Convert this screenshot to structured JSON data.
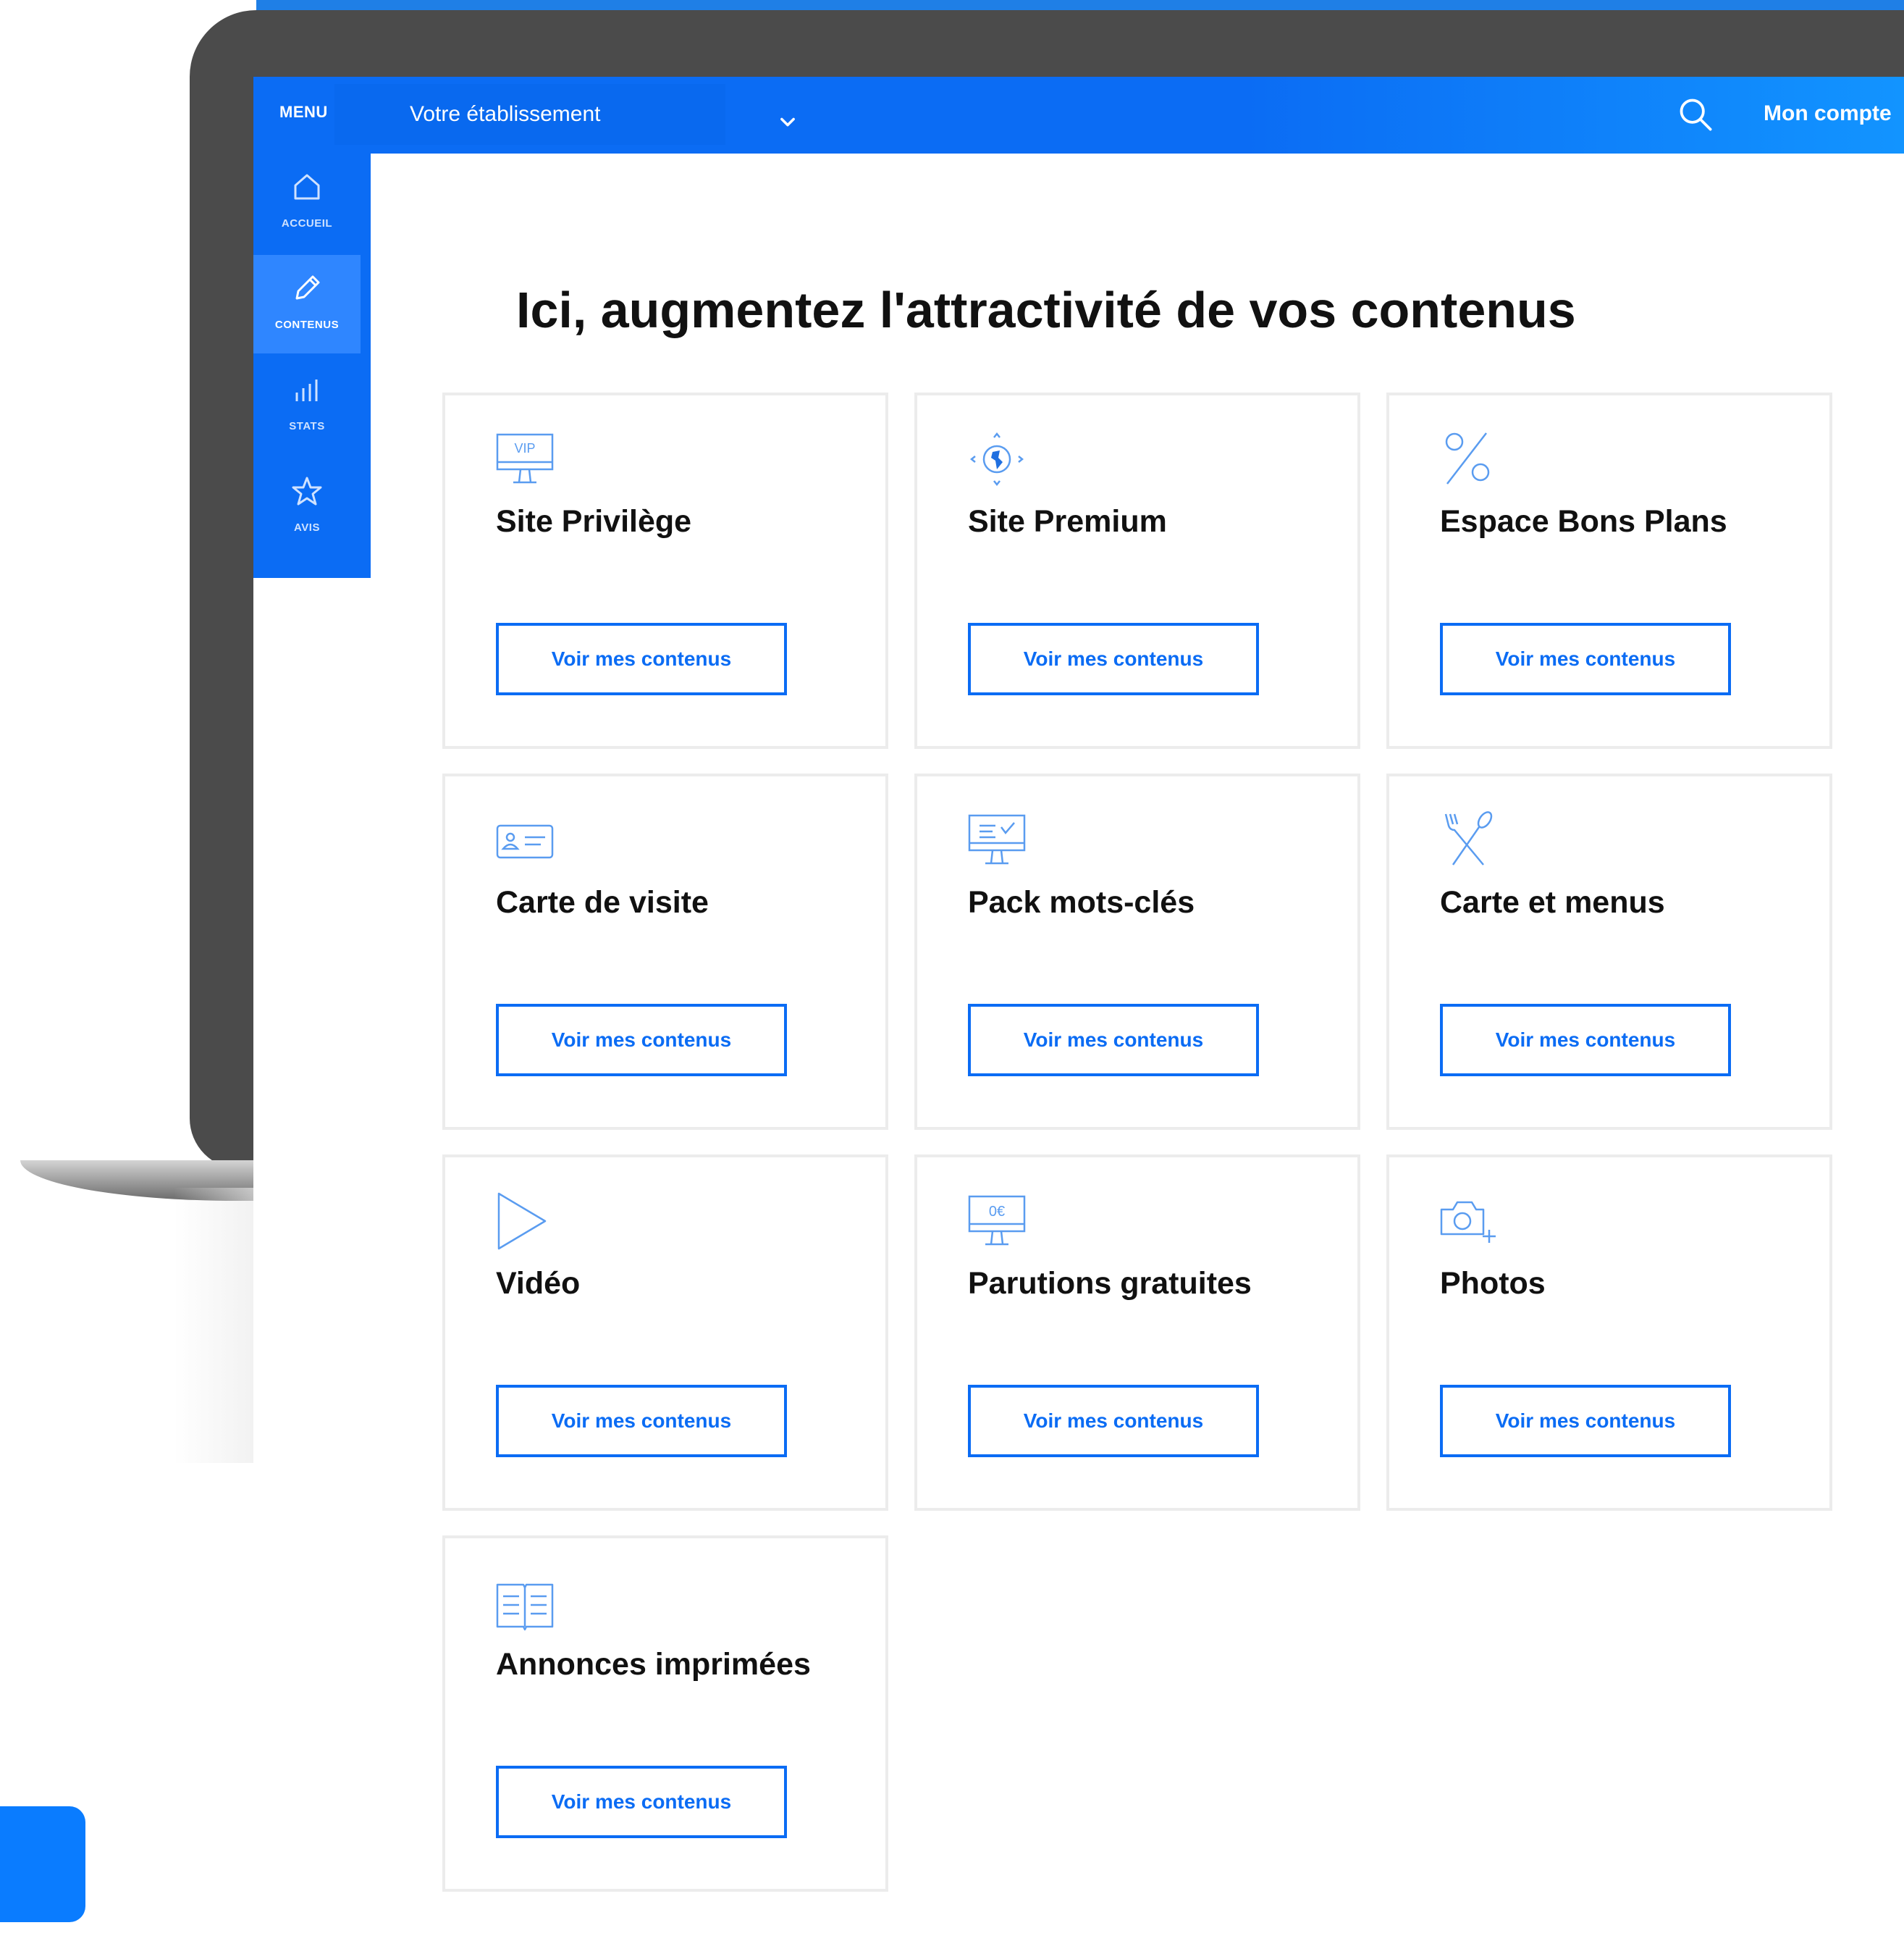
{
  "topbar": {
    "menu_label": "MENU",
    "establishment": "Votre établissement",
    "account": "Mon compte"
  },
  "sidebar": {
    "items": [
      {
        "label": "ACCUEIL",
        "icon": "home-icon"
      },
      {
        "label": "CONTENUS",
        "icon": "pencil-icon",
        "active": true
      },
      {
        "label": "STATS",
        "icon": "bar-chart-icon"
      },
      {
        "label": "AVIS",
        "icon": "star-icon"
      }
    ]
  },
  "main": {
    "heading": "Ici, augmentez l'attractivité de vos contenus",
    "cards": [
      {
        "title": "Site Privilège",
        "icon": "vip-monitor-icon",
        "button": "Voir mes contenus"
      },
      {
        "title": "Site Premium",
        "icon": "globe-arrows-icon",
        "button": "Voir mes contenus"
      },
      {
        "title": "Espace Bons Plans",
        "icon": "percent-icon",
        "button": "Voir mes contenus"
      },
      {
        "title": "Carte de visite",
        "icon": "business-card-icon",
        "button": "Voir mes contenus"
      },
      {
        "title": "Pack mots-clés",
        "icon": "keywords-monitor-icon",
        "button": "Voir mes contenus"
      },
      {
        "title": "Carte et menus",
        "icon": "cutlery-icon",
        "button": "Voir mes contenus"
      },
      {
        "title": "Vidéo",
        "icon": "play-icon",
        "button": "Voir mes contenus"
      },
      {
        "title": "Parutions gratuites",
        "icon": "euro-monitor-icon",
        "button": "Voir mes contenus"
      },
      {
        "title": "Photos",
        "icon": "camera-plus-icon",
        "button": "Voir mes contenus"
      },
      {
        "title": "Annonces imprimées",
        "icon": "open-book-icon",
        "button": "Voir mes contenus"
      }
    ]
  },
  "colors": {
    "accent": "#0b6cf4",
    "bezel": "#4b4b4b",
    "card_border": "#ececec",
    "icon_stroke": "#5a9cf0"
  }
}
